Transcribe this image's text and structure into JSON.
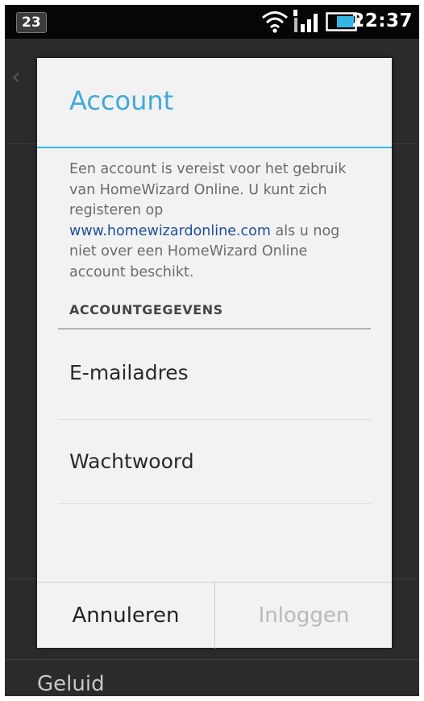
{
  "status_bar": {
    "notification_count": "23",
    "time": "22:37",
    "icons": [
      "wifi-icon",
      "signal-icon",
      "battery-icon"
    ]
  },
  "background": {
    "item_label": "Geluid",
    "icons": [
      "back-icon"
    ]
  },
  "dialog": {
    "title": "Account",
    "description": {
      "part1": "Een account is vereist voor het gebruik van HomeWizard Online. U kunt zich registeren op ",
      "link": "www.homewizardonline.com",
      "part2": " als u nog niet over een HomeWizard Online account beschikt."
    },
    "section_header": "ACCOUNTGEGEVENS",
    "email_placeholder": "E-mailadres",
    "password_placeholder": "Wachtwoord",
    "cancel_label": "Annuleren",
    "login_label": "Inloggen"
  },
  "colors": {
    "accent": "#33b5e5",
    "title": "#3fa9d8",
    "link": "#1f4f98",
    "disabled_text": "#b9b9b9"
  }
}
